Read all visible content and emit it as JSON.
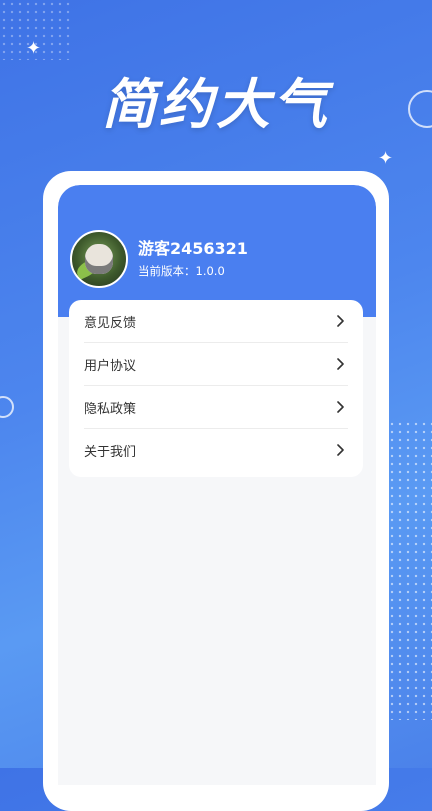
{
  "hero": {
    "title": "简约大气"
  },
  "profile": {
    "username": "游客2456321",
    "version_label": "当前版本：1.0.0"
  },
  "menu": {
    "items": [
      {
        "label": "意见反馈"
      },
      {
        "label": "用户协议"
      },
      {
        "label": "隐私政策"
      },
      {
        "label": "关于我们"
      }
    ]
  },
  "icons": {
    "menu_chevron": "chevron-right-icon",
    "avatar": "cat-avatar"
  },
  "colors": {
    "background": "#4d86ee",
    "header": "#4a7ff0",
    "card": "#ffffff",
    "panel": "#f6f7f9",
    "text": "#333333"
  }
}
